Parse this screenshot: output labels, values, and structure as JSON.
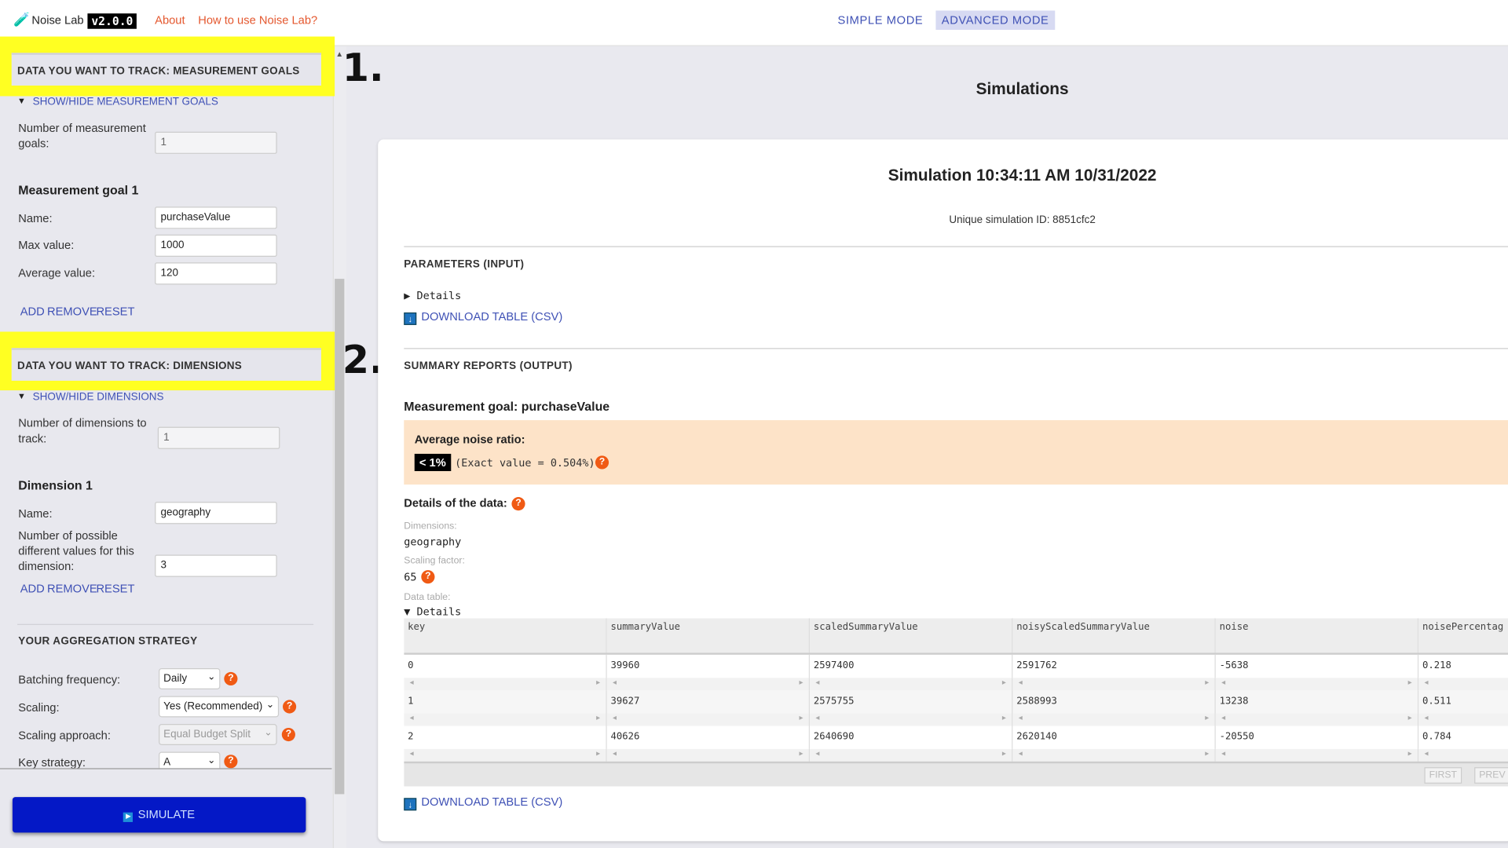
{
  "header": {
    "app_name": "Noise Lab",
    "version": "v2.0.0",
    "about": "About",
    "how_to": "How to use Noise Lab?",
    "simple_mode": "SIMPLE MODE",
    "advanced_mode": "ADVANCED MODE",
    "active_mode": "ADVANCED MODE"
  },
  "annotations": {
    "step1": "1.",
    "step2": "2.",
    "highlight_color": "#ffff22"
  },
  "sidebar": {
    "measurement": {
      "title": "DATA YOU WANT TO TRACK: MEASUREMENT GOALS",
      "toggle": "SHOW/HIDE MEASUREMENT GOALS",
      "count_label": "Number of measurement goals:",
      "count_value": "1",
      "goal_title": "Measurement goal 1",
      "name_label": "Name:",
      "name_value": "purchaseValue",
      "max_label": "Max value:",
      "max_value": "1000",
      "avg_label": "Average value:",
      "avg_value": "120",
      "add": "ADD",
      "remove": "REMOVE",
      "reset": "RESET"
    },
    "dimensions": {
      "title": "DATA YOU WANT TO TRACK: DIMENSIONS",
      "toggle": "SHOW/HIDE DIMENSIONS",
      "count_label": "Number of dimensions to track:",
      "count_value": "1",
      "dim_title": "Dimension 1",
      "name_label": "Name:",
      "name_value": "geography",
      "values_label": "Number of possible different values for this dimension:",
      "values_value": "3",
      "add": "ADD",
      "remove": "REMOVE",
      "reset": "RESET"
    },
    "strategy": {
      "title": "YOUR AGGREGATION STRATEGY",
      "batching_label": "Batching frequency:",
      "batching_value": "Daily",
      "scaling_label": "Scaling:",
      "scaling_value": "Yes (Recommended)",
      "approach_label": "Scaling approach:",
      "approach_value": "Equal Budget Split",
      "key_label": "Key strategy:",
      "key_value": "A",
      "help": "?"
    },
    "simulate": "SIMULATE"
  },
  "main": {
    "title": "Simulations",
    "sim_title": "Simulation 10:34:11 AM 10/31/2022",
    "sim_id": "Unique simulation ID: 8851cfc2",
    "params_heading": "PARAMETERS (INPUT)",
    "details": "Details",
    "download": "DOWNLOAD TABLE (CSV)",
    "summary_heading": "SUMMARY REPORTS (OUTPUT)",
    "goal_heading": "Measurement goal: purchaseValue",
    "noise_label": "Average noise ratio:",
    "noise_badge": "< 1%",
    "noise_exact": "(Exact value = 0.504%)",
    "noise_box_color": "#fde3c8",
    "details_of_data": "Details of the data:",
    "dimensions_label": "Dimensions:",
    "dimensions_value": "geography",
    "scaling_label": "Scaling factor:",
    "scaling_value": "65",
    "data_table_label": "Data table:",
    "table": {
      "columns": [
        "key",
        "summaryValue",
        "scaledSummaryValue",
        "noisyScaledSummaryValue",
        "noise",
        "noisePercentag"
      ],
      "rows": [
        [
          "0",
          "39960",
          "2597400",
          "2591762",
          "-5638",
          "0.218"
        ],
        [
          "1",
          "39627",
          "2575755",
          "2588993",
          "13238",
          "0.511"
        ],
        [
          "2",
          "40626",
          "2640690",
          "2620140",
          "-20550",
          "0.784"
        ]
      ],
      "first": "FIRST",
      "prev": "PREV"
    }
  }
}
